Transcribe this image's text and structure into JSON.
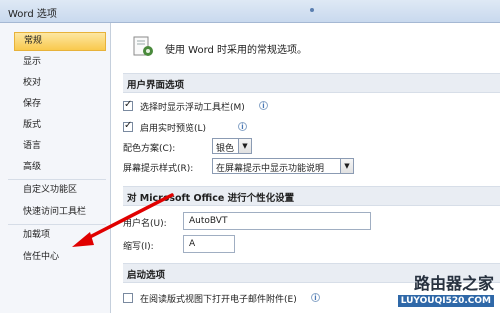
{
  "window": {
    "title": "Word 选项"
  },
  "nav": {
    "items": [
      "常规",
      "显示",
      "校对",
      "保存",
      "版式",
      "语言",
      "高级",
      "自定义功能区",
      "快速访问工具栏",
      "加载项",
      "信任中心"
    ],
    "selected": "常规"
  },
  "header": {
    "text": "使用 Word 时采用的常规选项。"
  },
  "ui_section": {
    "title": "用户界面选项",
    "option1": "选择时显示浮动工具栏(M)",
    "option2": "启用实时预览(L)",
    "color_label": "配色方案(C):",
    "color_value": "银色",
    "tooltip_label": "屏幕提示样式(R):",
    "tooltip_value": "在屏幕提示中显示功能说明"
  },
  "personal_section": {
    "title": "对 Microsoft Office 进行个性化设置",
    "username_label": "用户名(U):",
    "username_value": "AutoBVT",
    "initials_label": "缩写(I):",
    "initials_value": "A"
  },
  "startup_section": {
    "title": "启动选项",
    "option1": "在阅读版式视图下打开电子邮件附件(E)"
  },
  "watermark": {
    "line1": "路由器之家",
    "line2": "LUYOUQI520.COM"
  },
  "colors": {
    "selected_bg": "#f9c94e",
    "annotation_arrow": "#e00000",
    "accent": "#2f68a8"
  }
}
